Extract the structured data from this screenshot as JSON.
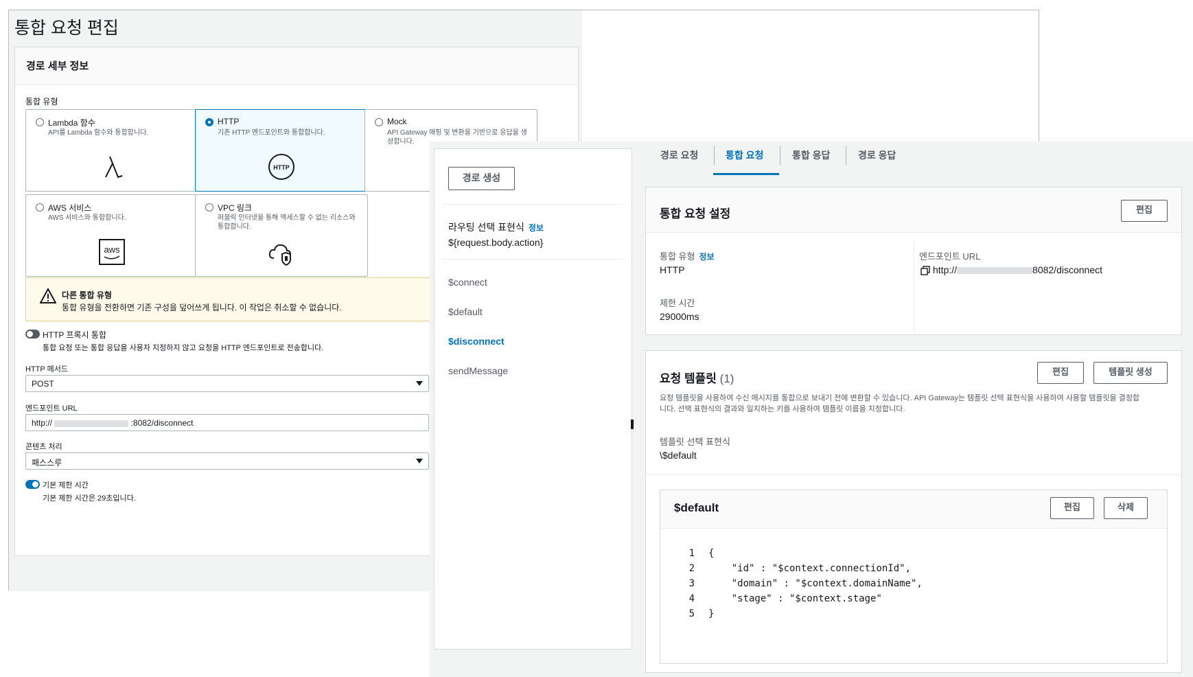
{
  "left_window": {
    "page_title": "통합 요청 편집",
    "section_title": "경로 세부 정보",
    "integration_type_label": "통합 유형",
    "tiles": [
      {
        "title": "Lambda 함수",
        "desc": "API를 Lambda 함수와 통합합니다.",
        "icon": "lambda-icon",
        "selected": false
      },
      {
        "title": "HTTP",
        "desc": "기존 HTTP 엔드포인트와 통합합니다.",
        "icon": "http-icon",
        "selected": true
      },
      {
        "title": "Mock",
        "desc": "API Gateway 매핑 및 변환을 기반으로 응답을 생성합니다.",
        "icon": "mock-icon",
        "selected": false
      },
      {
        "title": "AWS 서비스",
        "desc": "AWS 서비스와 통합합니다.",
        "icon": "aws-icon",
        "selected": false
      },
      {
        "title": "VPC 링크",
        "desc": "퍼블릭 인터넷을 통해 액세스할 수 없는 리소스와 통합합니다.",
        "icon": "vpc-cloud-icon",
        "selected": false
      }
    ],
    "warning": {
      "title": "다른 통합 유형",
      "text": "통합 유형을 전환하면 기존 구성을 덮어쓰게 됩니다. 이 작업은 취소할 수 없습니다."
    },
    "proxy_toggle": {
      "label": "HTTP 프록시 통합",
      "desc": "통합 요청 또는 통합 응답을 사용자 지정하지 않고 요청을 HTTP 엔드포인트로 전송합니다.",
      "on": false
    },
    "http_method": {
      "label": "HTTP 메서드",
      "value": "POST"
    },
    "endpoint_url": {
      "label": "엔드포인트 URL",
      "prefix": "http://",
      "suffix": ":8082/disconnect"
    },
    "content_handling": {
      "label": "콘텐츠 처리",
      "value": "패스스루"
    },
    "timeout_toggle": {
      "label": "기본 제한 시간",
      "desc": "기본 제한 시간은 29초입니다.",
      "on": true
    }
  },
  "routes": {
    "create_button": "경로 생성",
    "selection_label": "라우팅 선택 표현식",
    "info": "정보",
    "selection_expression": "${request.body.action}",
    "items": [
      "$connect",
      "$default",
      "$disconnect",
      "sendMessage"
    ],
    "active": "$disconnect"
  },
  "tabs": [
    "경로 요청",
    "통합 요청",
    "통합 응답",
    "경로 응답"
  ],
  "active_tab": "통합 요청",
  "settings": {
    "title": "통합 요청 설정",
    "edit": "편집",
    "type_label": "통합 유형",
    "info": "정보",
    "type_value": "HTTP",
    "timeout_label": "제한 시간",
    "timeout_value": "29000ms",
    "endpoint_label": "엔드포인트 URL",
    "endpoint_prefix": "http://",
    "endpoint_suffix": "8082/disconnect"
  },
  "templates": {
    "title": "요청 템플릿",
    "count": "(1)",
    "edit": "편집",
    "create": "템플릿 생성",
    "desc_line1": "요청 템플릿을 사용하여 수신 메시지를 통합으로 보내기 전에 변환할 수 있습니다. API Gateway는 템플릿 선택 표현식을 사용하여 사용할 템플릿을 결정합",
    "desc_line2": "니다. 선택 표현식의 결과와 일치하는 키를 사용하여 템플릿 이름을 지정합니다.",
    "selection_label": "템플릿 선택 표현식",
    "selection_value": "\\$default"
  },
  "default_template": {
    "title": "$default",
    "edit": "편집",
    "delete": "삭제",
    "lines": [
      {
        "num": "1",
        "code": "{"
      },
      {
        "num": "2",
        "code": "    \"id\" : \"$context.connectionId\","
      },
      {
        "num": "3",
        "code": "    \"domain\" : \"$context.domainName\","
      },
      {
        "num": "4",
        "code": "    \"stage\" : \"$context.stage\""
      },
      {
        "num": "5",
        "code": "}"
      }
    ]
  },
  "colors": {
    "accent": "#0073bb",
    "warning_bg": "#fffbea"
  }
}
